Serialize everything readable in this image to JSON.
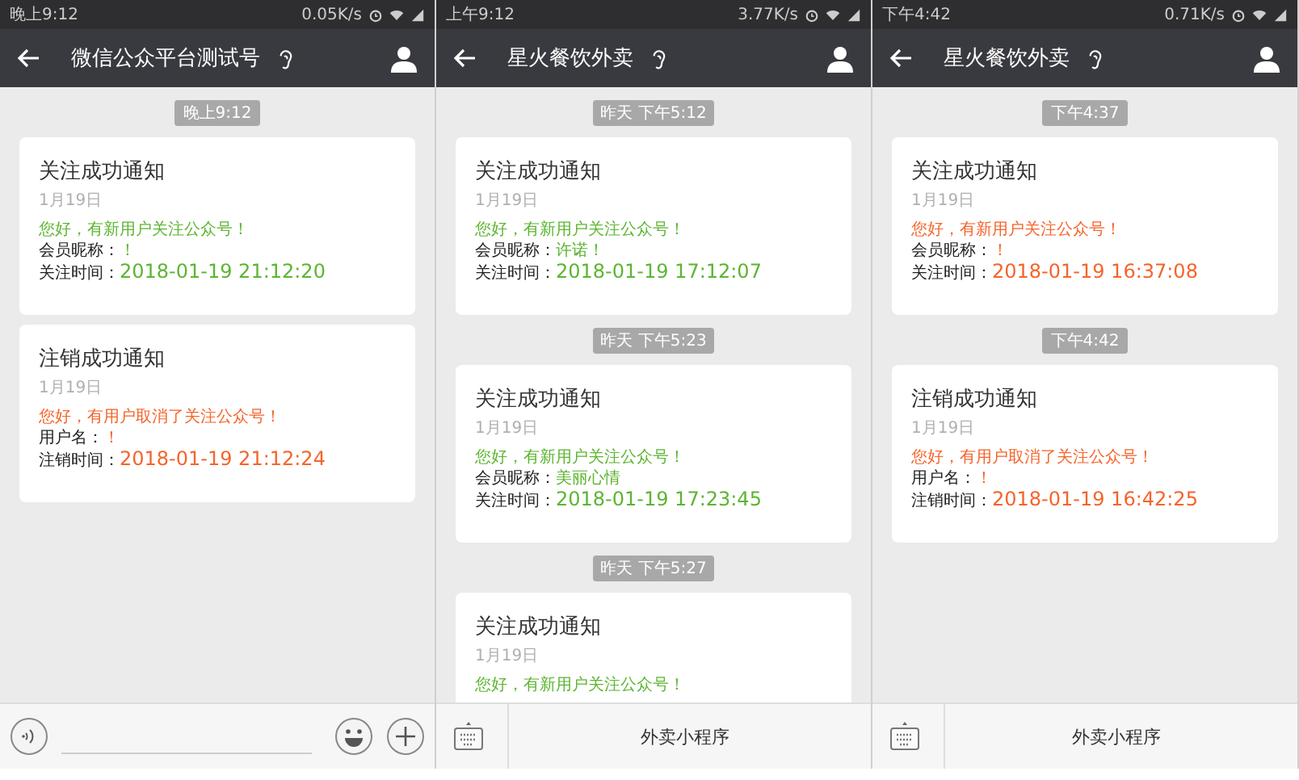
{
  "phones": [
    {
      "status_bar": {
        "time": "晚上9:12",
        "speed": "0.05K/s"
      },
      "header": {
        "title": "微信公众平台测试号"
      },
      "messages": [
        {
          "timestamp": "晚上9:12",
          "title": "关注成功通知",
          "date": "1月19日",
          "greeting": "您好，有新用户关注公众号！",
          "color": "#5cb531",
          "fields": [
            {
              "kind": "text",
              "label": "会员昵称：",
              "value": "！"
            },
            {
              "kind": "time",
              "label": "关注时间：",
              "value": "2018-01-19 21:12:20"
            }
          ]
        },
        {
          "title": "注销成功通知",
          "date": "1月19日",
          "greeting": "您好，有用户取消了关注公众号！",
          "color": "#f5642a",
          "fields": [
            {
              "kind": "text",
              "label": "用户名：",
              "value": "！"
            },
            {
              "kind": "time",
              "label": "注销时间：",
              "value": "2018-01-19 21:12:24"
            }
          ]
        }
      ],
      "footer": {
        "kind": "input"
      }
    },
    {
      "status_bar": {
        "time": "上午9:12",
        "speed": "3.77K/s"
      },
      "header": {
        "title": "星火餐饮外卖"
      },
      "messages": [
        {
          "timestamp": "昨天 下午5:12",
          "title": "关注成功通知",
          "date": "1月19日",
          "greeting": "您好，有新用户关注公众号！",
          "color": "#5cb531",
          "fields": [
            {
              "kind": "text",
              "label": "会员昵称：",
              "value": "许诺！"
            },
            {
              "kind": "time",
              "label": "关注时间：",
              "value": "2018-01-19 17:12:07"
            }
          ]
        },
        {
          "timestamp": "昨天 下午5:23",
          "title": "关注成功通知",
          "date": "1月19日",
          "greeting": "您好，有新用户关注公众号！",
          "color": "#5cb531",
          "fields": [
            {
              "kind": "text",
              "label": "会员昵称：",
              "value": "美丽心情"
            },
            {
              "kind": "time",
              "label": "关注时间：",
              "value": "2018-01-19 17:23:45"
            }
          ]
        },
        {
          "timestamp": "昨天 下午5:27",
          "title": "关注成功通知",
          "date": "1月19日",
          "greeting": "您好，有新用户关注公众号！",
          "color": "#5cb531"
        }
      ],
      "footer": {
        "kind": "menu",
        "menu_label": "外卖小程序"
      }
    },
    {
      "status_bar": {
        "time": "下午4:42",
        "speed": "0.71K/s"
      },
      "header": {
        "title": "星火餐饮外卖"
      },
      "messages": [
        {
          "timestamp": "下午4:37",
          "title": "关注成功通知",
          "date": "1月19日",
          "greeting": "您好，有新用户关注公众号！",
          "color": "#f5642a",
          "fields": [
            {
              "kind": "text",
              "label": "会员昵称：",
              "value": "！"
            },
            {
              "kind": "time",
              "label": "关注时间：",
              "value": "2018-01-19 16:37:08"
            }
          ]
        },
        {
          "timestamp": "下午4:42",
          "title": "注销成功通知",
          "date": "1月19日",
          "greeting": "您好，有用户取消了关注公众号！",
          "color": "#f5642a",
          "fields": [
            {
              "kind": "text",
              "label": "用户名：",
              "value": "！"
            },
            {
              "kind": "time",
              "label": "注销时间：",
              "value": "2018-01-19 16:42:25"
            }
          ]
        }
      ],
      "footer": {
        "kind": "menu",
        "menu_label": "外卖小程序"
      }
    }
  ]
}
